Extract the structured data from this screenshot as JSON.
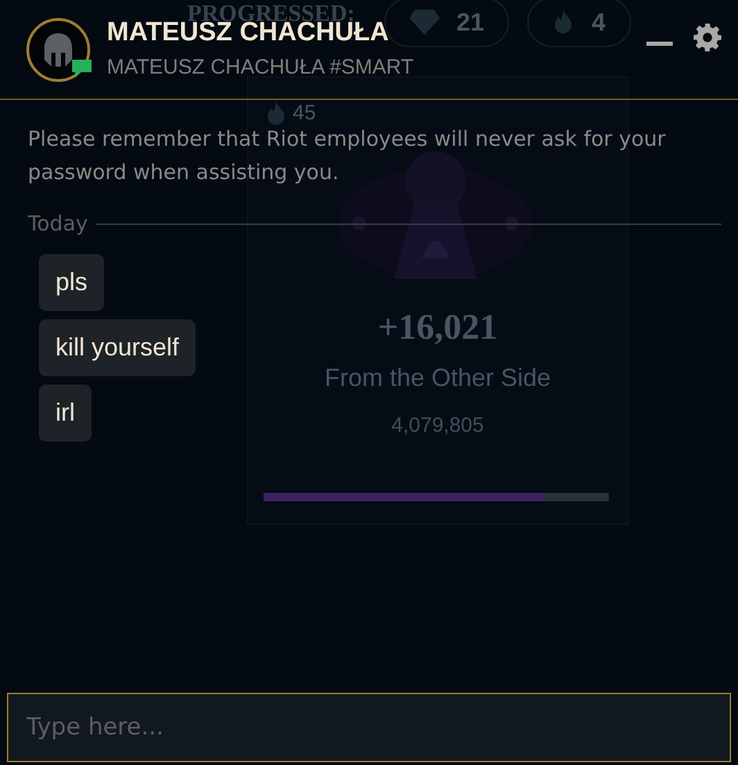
{
  "backdrop": {
    "heading": "PROGRESSED:",
    "pills": [
      {
        "kind": "gem",
        "count": "21"
      },
      {
        "kind": "flame",
        "count": "4"
      }
    ],
    "card": {
      "points": "45",
      "gain": "+16,021",
      "title": "From the Other Side",
      "total": "4,079,805",
      "level": 0.81
    }
  },
  "header": {
    "name": "MATEUSZ CHACHUŁA",
    "riot_id": "MATEUSZ CHACHUŁA #SMART",
    "on_mobile": true
  },
  "notice": "Please remember that Riot employees will never ask for your password when assisting you.",
  "day_label": "Today",
  "messages": [
    {
      "text": "pls"
    },
    {
      "text": "kill yourself"
    },
    {
      "text": "irl"
    }
  ],
  "input": {
    "placeholder": "Type here..."
  }
}
